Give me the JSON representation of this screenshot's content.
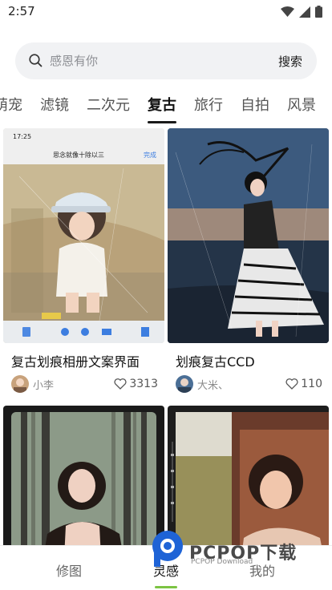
{
  "status": {
    "time": "2:57"
  },
  "search": {
    "placeholder": "感恩有你",
    "button": "搜索"
  },
  "tabs": [
    {
      "label": "萌宠",
      "active": false
    },
    {
      "label": "滤镜",
      "active": false
    },
    {
      "label": "二次元",
      "active": false
    },
    {
      "label": "复古",
      "active": true
    },
    {
      "label": "旅行",
      "active": false
    },
    {
      "label": "自拍",
      "active": false
    },
    {
      "label": "风景",
      "active": false
    }
  ],
  "cards": [
    {
      "title": "复古划痕相册文案界面",
      "author": "小李",
      "likes": "3313",
      "overlay": {
        "time": "17:25",
        "album_title": "思念就像十除以三",
        "done": "完成"
      }
    },
    {
      "title": "划痕复古CCD",
      "author": "大米、",
      "likes": "110"
    },
    {
      "title": "",
      "author": "",
      "likes": ""
    },
    {
      "title": "",
      "author": "",
      "likes": ""
    }
  ],
  "bottom_nav": [
    {
      "label": "修图",
      "active": false
    },
    {
      "label": "灵感",
      "active": true
    },
    {
      "label": "我的",
      "active": false
    }
  ],
  "watermark": {
    "brand": "PCPOP下载",
    "sub": "PCPOP Download"
  },
  "colors": {
    "accent": "#7cc443",
    "search_bg": "#f1f2f4"
  }
}
